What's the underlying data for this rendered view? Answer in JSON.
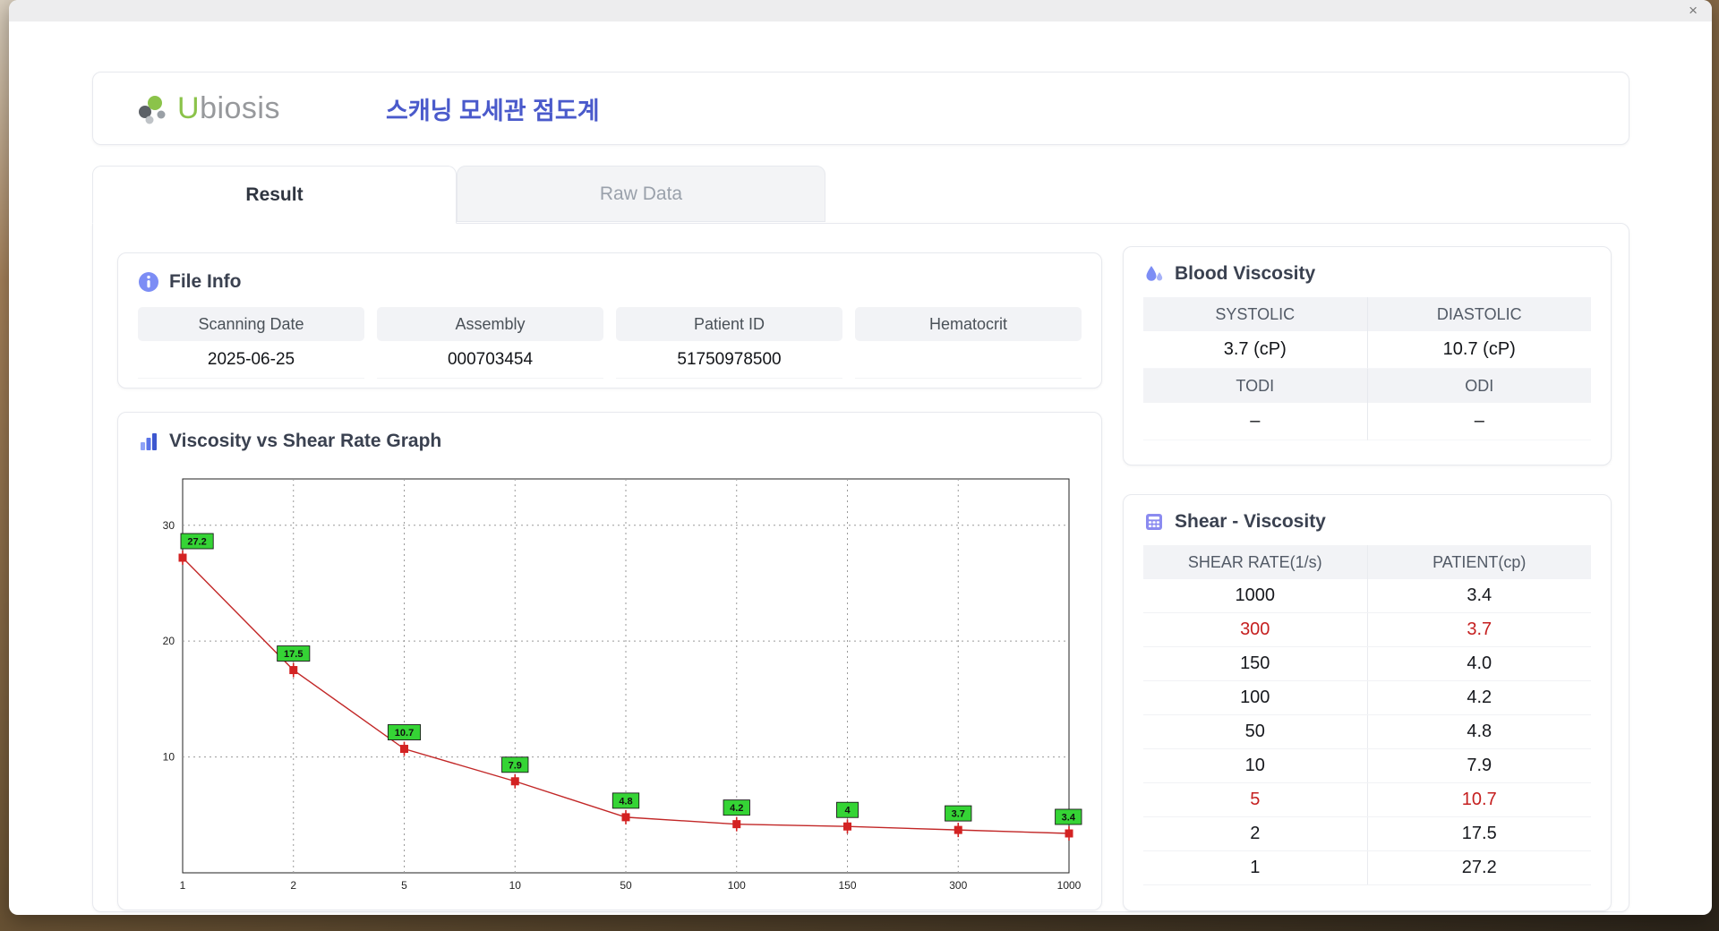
{
  "window": {
    "close_icon": "×"
  },
  "header": {
    "brand_u": "U",
    "brand_rest": "biosis",
    "app_title": "스캐닝 모세관 점도계"
  },
  "tabs": {
    "result": "Result",
    "raw_data": "Raw Data"
  },
  "file_info": {
    "title": "File Info",
    "fields": [
      {
        "label": "Scanning Date",
        "value": "2025-06-25"
      },
      {
        "label": "Assembly",
        "value": "000703454"
      },
      {
        "label": "Patient ID",
        "value": "51750978500"
      },
      {
        "label": "Hematocrit",
        "value": ""
      }
    ]
  },
  "blood_viscosity": {
    "title": "Blood Viscosity",
    "sections": [
      {
        "headers": [
          "SYSTOLIC",
          "DIASTOLIC"
        ],
        "values": [
          "3.7 (cP)",
          "10.7 (cP)"
        ]
      },
      {
        "headers": [
          "TODI",
          "ODI"
        ],
        "values": [
          "–",
          "–"
        ]
      }
    ]
  },
  "chart_data": {
    "type": "line",
    "title": "Viscosity vs Shear Rate Graph",
    "xlabel": "",
    "ylabel": "",
    "x": [
      1,
      2,
      5,
      10,
      50,
      100,
      150,
      300,
      1000
    ],
    "x_axis_type": "categorical-evenly-spaced",
    "values": [
      27.2,
      17.5,
      10.7,
      7.9,
      4.8,
      4.2,
      4,
      3.7,
      3.4
    ],
    "labels": [
      "27.2",
      "17.5",
      "10.7",
      "7.9",
      "4.8",
      "4.2",
      "4",
      "3.7",
      "3.4"
    ],
    "yticks": [
      10,
      20,
      30
    ],
    "ylim": [
      0,
      34
    ],
    "grid": true,
    "line_color": "#c22727",
    "marker_color": "#d32222",
    "label_bg": "#35d435",
    "label_border": "#1a1a1a"
  },
  "shear_viscosity": {
    "title": "Shear - Viscosity",
    "columns": [
      "SHEAR RATE(1/s)",
      "PATIENT(cp)"
    ],
    "highlight_color": "#c51f1f",
    "rows": [
      {
        "shear": "1000",
        "patient": "3.4",
        "highlight": false
      },
      {
        "shear": "300",
        "patient": "3.7",
        "highlight": true
      },
      {
        "shear": "150",
        "patient": "4.0",
        "highlight": false
      },
      {
        "shear": "100",
        "patient": "4.2",
        "highlight": false
      },
      {
        "shear": "50",
        "patient": "4.8",
        "highlight": false
      },
      {
        "shear": "10",
        "patient": "7.9",
        "highlight": false
      },
      {
        "shear": "5",
        "patient": "10.7",
        "highlight": true
      },
      {
        "shear": "2",
        "patient": "17.5",
        "highlight": false
      },
      {
        "shear": "1",
        "patient": "27.2",
        "highlight": false
      }
    ]
  }
}
